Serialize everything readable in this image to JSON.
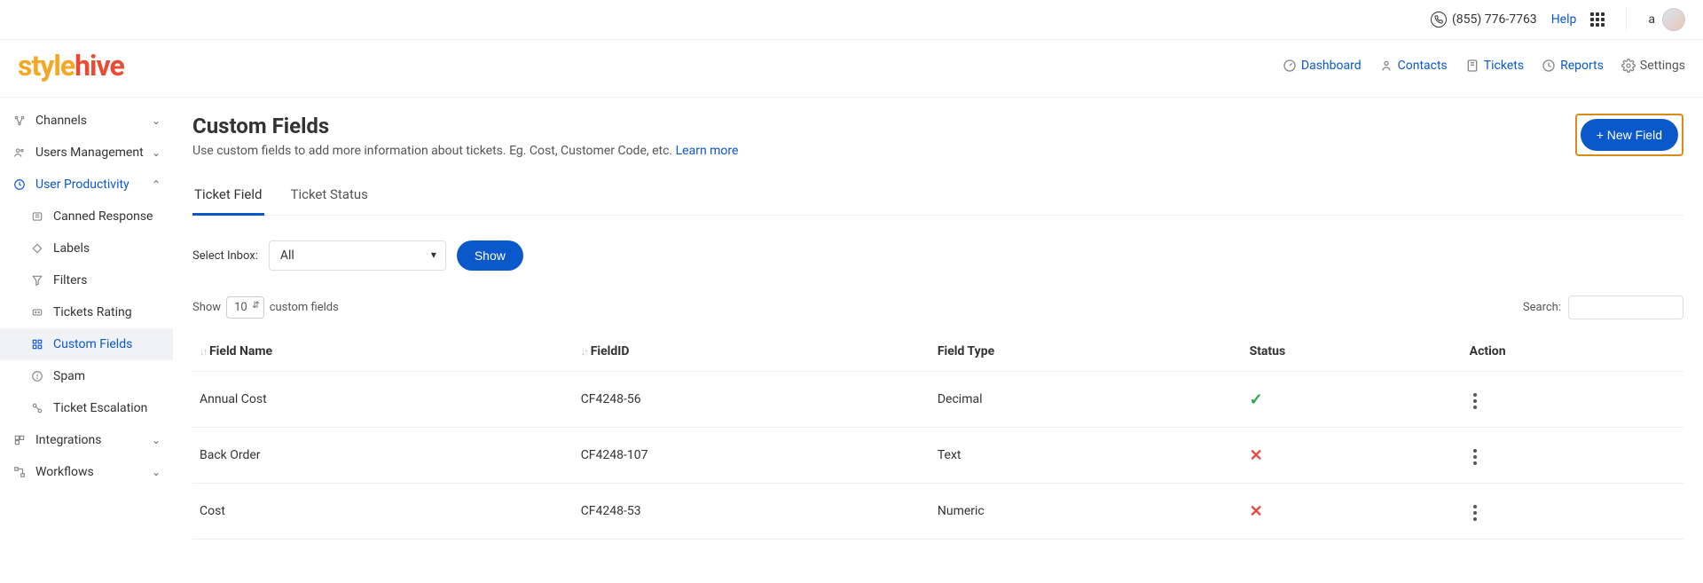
{
  "topbar": {
    "phone": "(855) 776-7763",
    "help": "Help",
    "user_label": "a"
  },
  "logo": {
    "part1": "style",
    "part2": "hive"
  },
  "topnav": [
    {
      "label": "Dashboard",
      "icon": "dashboard-icon"
    },
    {
      "label": "Contacts",
      "icon": "contacts-icon"
    },
    {
      "label": "Tickets",
      "icon": "tickets-icon"
    },
    {
      "label": "Reports",
      "icon": "reports-icon"
    },
    {
      "label": "Settings",
      "icon": "settings-icon"
    }
  ],
  "sidebar": {
    "channels": "Channels",
    "users_mgmt": "Users Management",
    "user_prod": "User Productivity",
    "subitems": {
      "canned": "Canned Response",
      "labels": "Labels",
      "filters": "Filters",
      "ratings": "Tickets Rating",
      "custom_fields": "Custom Fields",
      "spam": "Spam",
      "escalation": "Ticket Escalation"
    },
    "integrations": "Integrations",
    "workflows": "Workflows"
  },
  "page": {
    "title": "Custom Fields",
    "subtitle": "Use custom fields to add more information about tickets. Eg. Cost, Customer Code, etc.",
    "learn_more": "Learn more",
    "new_field_btn": "+ New Field"
  },
  "tabs": {
    "ticket_field": "Ticket Field",
    "ticket_status": "Ticket Status"
  },
  "filter": {
    "select_inbox_label": "Select Inbox:",
    "selected_inbox": "All",
    "show_btn": "Show"
  },
  "tabletools": {
    "show_label": "Show",
    "entries_value": "10",
    "entries_suffix": "custom fields",
    "search_label": "Search:"
  },
  "columns": {
    "field_name": "Field Name",
    "field_id": "FieldID",
    "field_type": "Field Type",
    "status": "Status",
    "action": "Action"
  },
  "rows": [
    {
      "name": "Annual Cost",
      "id": "CF4248-56",
      "type": "Decimal",
      "status": true
    },
    {
      "name": "Back Order",
      "id": "CF4248-107",
      "type": "Text",
      "status": false
    },
    {
      "name": "Cost",
      "id": "CF4248-53",
      "type": "Numeric",
      "status": false
    }
  ]
}
